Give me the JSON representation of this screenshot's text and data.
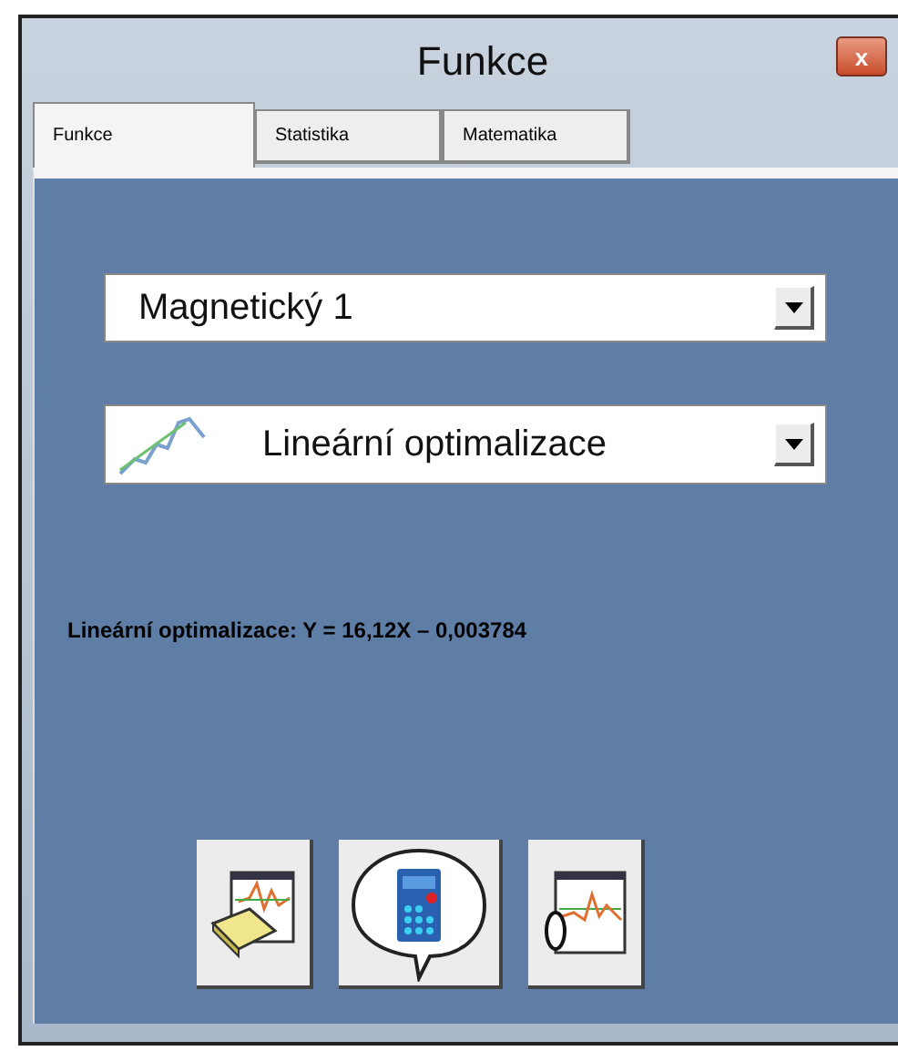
{
  "window": {
    "title": "Funkce",
    "close": "x"
  },
  "tabs": [
    {
      "label": "Funkce",
      "selected": true
    },
    {
      "label": "Statistika",
      "selected": false
    },
    {
      "label": "Matematika",
      "selected": false
    }
  ],
  "sensor_select": {
    "value": "Magnetický 1"
  },
  "function_select": {
    "value": "Lineární optimalizace"
  },
  "result": "Lineární optimalizace: Y = 16,12X – 0,003784",
  "buttons": [
    {
      "kind": "erase"
    },
    {
      "kind": "calculate"
    },
    {
      "kind": "zoom"
    }
  ]
}
